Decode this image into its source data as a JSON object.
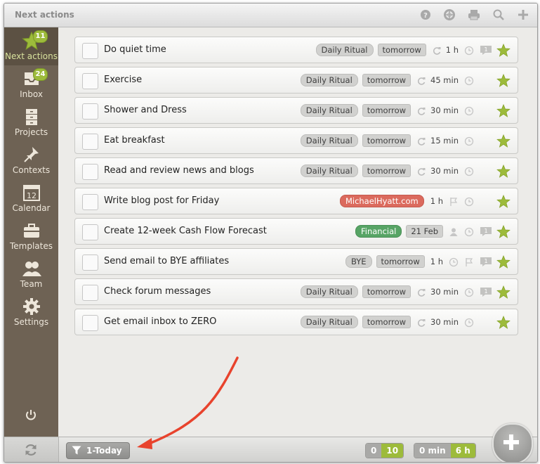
{
  "window": {
    "title": "Next actions"
  },
  "toolbar": {
    "icons": [
      "help-icon",
      "lifebuoy-icon",
      "print-icon",
      "search-icon",
      "plus-icon"
    ]
  },
  "sidebar": {
    "items": [
      {
        "label": "Next actions",
        "icon": "star-icon",
        "badge": "11",
        "active": true
      },
      {
        "label": "Inbox",
        "icon": "inbox-icon",
        "badge": "24"
      },
      {
        "label": "Projects",
        "icon": "projects-icon"
      },
      {
        "label": "Contexts",
        "icon": "pin-icon"
      },
      {
        "label": "Calendar",
        "icon": "calendar-icon",
        "day": "12"
      },
      {
        "label": "Templates",
        "icon": "toolbox-icon"
      },
      {
        "label": "Team",
        "icon": "team-icon"
      },
      {
        "label": "Settings",
        "icon": "gear-icon"
      }
    ]
  },
  "tasks": [
    {
      "name": "Do quiet time",
      "tag": "Daily Ritual",
      "date": "tomorrow",
      "repeat": true,
      "duration": "1 h",
      "clock": true,
      "comment": "1",
      "starred": true
    },
    {
      "name": "Exercise",
      "tag": "Daily Ritual",
      "date": "tomorrow",
      "repeat": true,
      "duration": "45 min",
      "clock": true,
      "starred": true
    },
    {
      "name": "Shower and Dress",
      "tag": "Daily Ritual",
      "date": "tomorrow",
      "repeat": true,
      "duration": "30 min",
      "clock": true,
      "starred": true
    },
    {
      "name": "Eat breakfast",
      "tag": "Daily Ritual",
      "date": "tomorrow",
      "repeat": true,
      "duration": "15 min",
      "clock": true,
      "starred": true
    },
    {
      "name": "Read and review news and blogs",
      "tag": "Daily Ritual",
      "date": "tomorrow",
      "repeat": true,
      "duration": "30 min",
      "clock": true,
      "starred": true
    },
    {
      "name": "Write blog post for Friday",
      "tag": "MichaelHyatt.com",
      "tag_color": "red",
      "duration": "1 h",
      "flag": true,
      "clock": true,
      "starred": true
    },
    {
      "name": "Create 12-week Cash Flow Forecast",
      "tag": "Financial",
      "tag_color": "green",
      "date": "21 Feb",
      "person": true,
      "clock": true,
      "comment": "1",
      "starred": true
    },
    {
      "name": "Send email to BYE affiliates",
      "tag": "BYE",
      "date": "tomorrow",
      "duration": "1 h",
      "clock": true,
      "flag": true,
      "comment": "1",
      "starred": true
    },
    {
      "name": "Check forum messages",
      "tag": "Daily Ritual",
      "date": "tomorrow",
      "repeat": true,
      "duration": "30 min",
      "clock": true,
      "comment": "1",
      "starred": true
    },
    {
      "name": "Get email inbox to ZERO",
      "tag": "Daily Ritual",
      "date": "tomorrow",
      "repeat": true,
      "duration": "30 min",
      "clock": true,
      "starred": true
    }
  ],
  "bottom": {
    "filter_label": "1-Today",
    "count_a": "0",
    "count_b": "10",
    "time_a": "0 min",
    "time_b": "6 h"
  },
  "colors": {
    "accent_green": "#9dbb3b",
    "sidebar": "#6e6254",
    "star": "#9dbb3b",
    "annotation_arrow": "#e8432d"
  }
}
